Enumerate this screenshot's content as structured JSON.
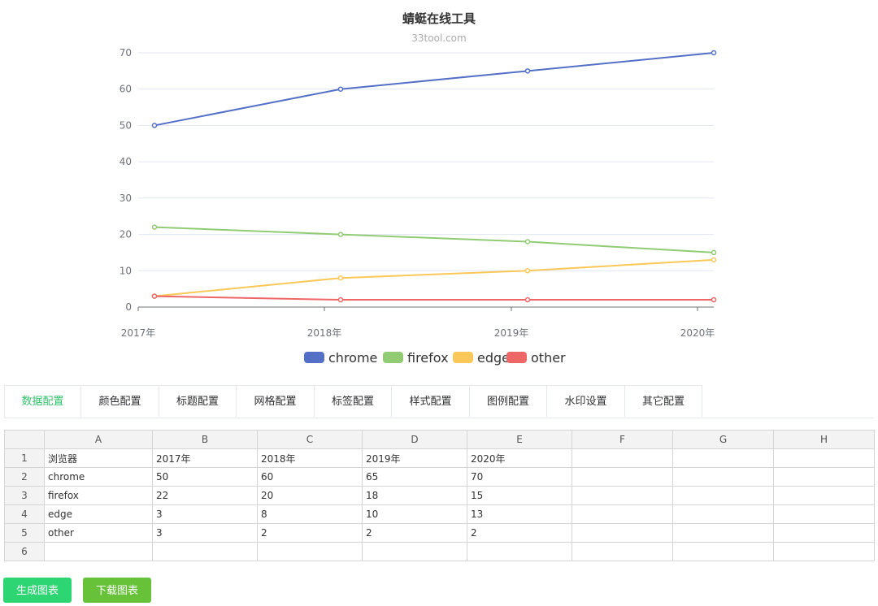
{
  "chart_data": {
    "type": "line",
    "title": "蜻蜓在线工具",
    "subtitle": "33tool.com",
    "x": [
      "2017年",
      "2018年",
      "2019年",
      "2020年"
    ],
    "yticks": [
      0,
      10,
      20,
      30,
      40,
      50,
      60,
      70
    ],
    "ylim": [
      0,
      70
    ],
    "grid": true,
    "legend_position": "bottom",
    "series": [
      {
        "name": "chrome",
        "values": [
          50,
          60,
          65,
          70
        ],
        "color": "#5470c6"
      },
      {
        "name": "firefox",
        "values": [
          22,
          20,
          18,
          15
        ],
        "color": "#91cc75"
      },
      {
        "name": "edge",
        "values": [
          3,
          8,
          10,
          13
        ],
        "color": "#fac858"
      },
      {
        "name": "other",
        "values": [
          3,
          2,
          2,
          2
        ],
        "color": "#ee6666"
      }
    ]
  },
  "tabs": [
    "数据配置",
    "颜色配置",
    "标题配置",
    "网格配置",
    "标签配置",
    "样式配置",
    "图例配置",
    "水印设置",
    "其它配置"
  ],
  "active_tab": 0,
  "accent_color": "#2fc26b",
  "sheet": {
    "columns": [
      "A",
      "B",
      "C",
      "D",
      "E",
      "F",
      "G",
      "H"
    ],
    "rows": [
      [
        "1",
        "浏览器",
        "2017年",
        "2018年",
        "2019年",
        "2020年",
        "",
        "",
        ""
      ],
      [
        "2",
        "chrome",
        "50",
        "60",
        "65",
        "70",
        "",
        "",
        ""
      ],
      [
        "3",
        "firefox",
        "22",
        "20",
        "18",
        "15",
        "",
        "",
        ""
      ],
      [
        "4",
        "edge",
        "3",
        "8",
        "10",
        "13",
        "",
        "",
        ""
      ],
      [
        "5",
        "other",
        "3",
        "2",
        "2",
        "2",
        "",
        "",
        ""
      ],
      [
        "6",
        "",
        "",
        "",
        "",
        "",
        "",
        "",
        ""
      ]
    ]
  },
  "buttons": {
    "generate": "生成图表",
    "download": "下载图表"
  }
}
